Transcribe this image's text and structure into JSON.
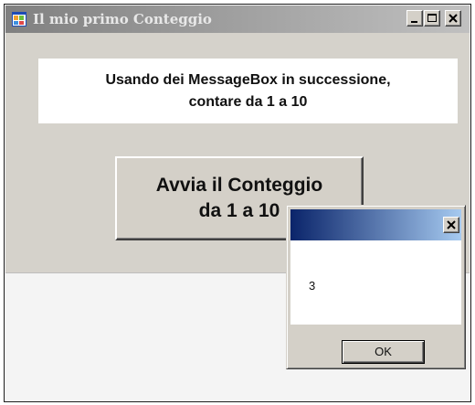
{
  "main_window": {
    "title": "Il mio primo Conteggio",
    "instruction_lines": [
      "Usando dei MessageBox in successione,",
      "contare da 1 a 10"
    ],
    "count_button_lines": [
      "Avvia il Conteggio",
      "da 1 a 10"
    ]
  },
  "message_box": {
    "title": "",
    "message": "3",
    "ok_label": "OK"
  },
  "icons": {
    "app": "windows-form-icon",
    "minimize": "minimize-icon",
    "maximize": "maximize-icon",
    "close": "close-icon"
  },
  "colors": {
    "inactive_title_start": "#808080",
    "inactive_title_end": "#c0c0c0",
    "active_title_start": "#0a246a",
    "active_title_end": "#a6caf0",
    "face": "#d4d0c8"
  }
}
